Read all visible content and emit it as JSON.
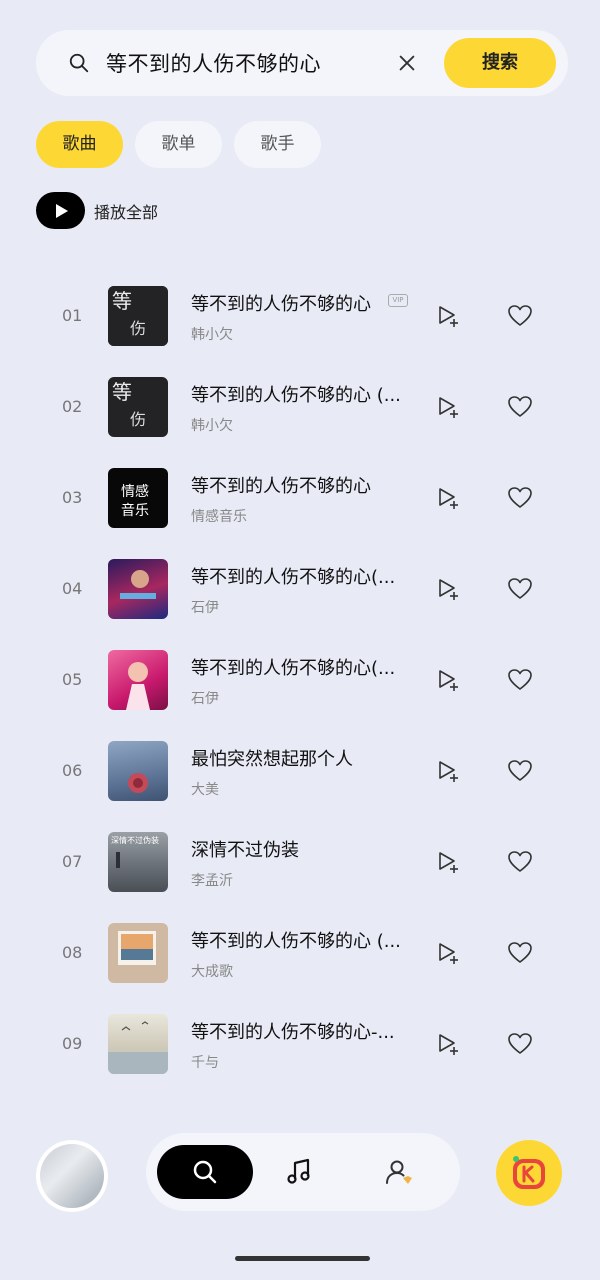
{
  "search": {
    "query": "等不到的人伤不够的心",
    "button_label": "搜索"
  },
  "tabs": [
    {
      "label": "歌曲",
      "active": true
    },
    {
      "label": "歌单",
      "active": false
    },
    {
      "label": "歌手",
      "active": false
    }
  ],
  "play_all": {
    "label": "播放全部"
  },
  "songs": [
    {
      "rank": "01",
      "title": "等不到的人伤不够的心",
      "artist": "韩小欠",
      "vip": "VIP",
      "cover_text": "等 伤"
    },
    {
      "rank": "02",
      "title": "等不到的人伤不够的心 (...",
      "artist": "韩小欠",
      "cover_text": "等 伤"
    },
    {
      "rank": "03",
      "title": "等不到的人伤不够的心",
      "artist": "情感音乐",
      "cover_text": "情感 音乐"
    },
    {
      "rank": "04",
      "title": "等不到的人伤不够的心(...",
      "artist": "石伊",
      "cover_text": ""
    },
    {
      "rank": "05",
      "title": "等不到的人伤不够的心(...",
      "artist": "石伊",
      "cover_text": ""
    },
    {
      "rank": "06",
      "title": "最怕突然想起那个人",
      "artist": "大美",
      "cover_text": ""
    },
    {
      "rank": "07",
      "title": "深情不过伪装",
      "artist": "李孟沂",
      "cover_text": "深情不过伪装"
    },
    {
      "rank": "08",
      "title": "等不到的人伤不够的心 (...",
      "artist": "大成歌",
      "cover_text": ""
    },
    {
      "rank": "09",
      "title": "等不到的人伤不够的心-...",
      "artist": "千与",
      "cover_text": ""
    }
  ],
  "colors": {
    "accent": "#fdd835",
    "background": "#e8ebf6",
    "card": "#f4f5fb"
  },
  "icons": [
    "search-icon",
    "clear-icon",
    "play-icon",
    "add-to-playlist-icon",
    "heart-icon",
    "music-note-icon",
    "user-icon",
    "k-song-icon"
  ]
}
